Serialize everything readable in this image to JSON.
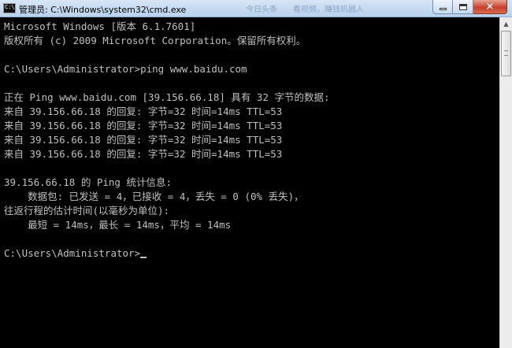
{
  "window": {
    "title": "管理员: C:\\Windows\\system32\\cmd.exe",
    "icon_label": "C:\\",
    "background_ghost_text_1": "今日头条",
    "background_ghost_text_2": "看视频，赚钱机器人",
    "controls": {
      "minimize": "minimize-icon",
      "maximize": "maximize-icon",
      "close": "×"
    }
  },
  "console": {
    "lines": [
      "Microsoft Windows [版本 6.1.7601]",
      "版权所有 (c) 2009 Microsoft Corporation。保留所有权利。",
      "",
      "C:\\Users\\Administrator>ping www.baidu.com",
      "",
      "正在 Ping www.baidu.com [39.156.66.18] 具有 32 字节的数据:",
      "来自 39.156.66.18 的回复: 字节=32 时间=14ms TTL=53",
      "来自 39.156.66.18 的回复: 字节=32 时间=14ms TTL=53",
      "来自 39.156.66.18 的回复: 字节=32 时间=14ms TTL=53",
      "来自 39.156.66.18 的回复: 字节=32 时间=14ms TTL=53",
      "",
      "39.156.66.18 的 Ping 统计信息:",
      "    数据包: 已发送 = 4，已接收 = 4，丢失 = 0 (0% 丢失)，",
      "往返行程的估计时间(以毫秒为单位):",
      "    最短 = 14ms，最长 = 14ms，平均 = 14ms",
      "",
      "C:\\Users\\Administrator>"
    ],
    "text_color": "#c0c0c0",
    "background_color": "#000000"
  }
}
